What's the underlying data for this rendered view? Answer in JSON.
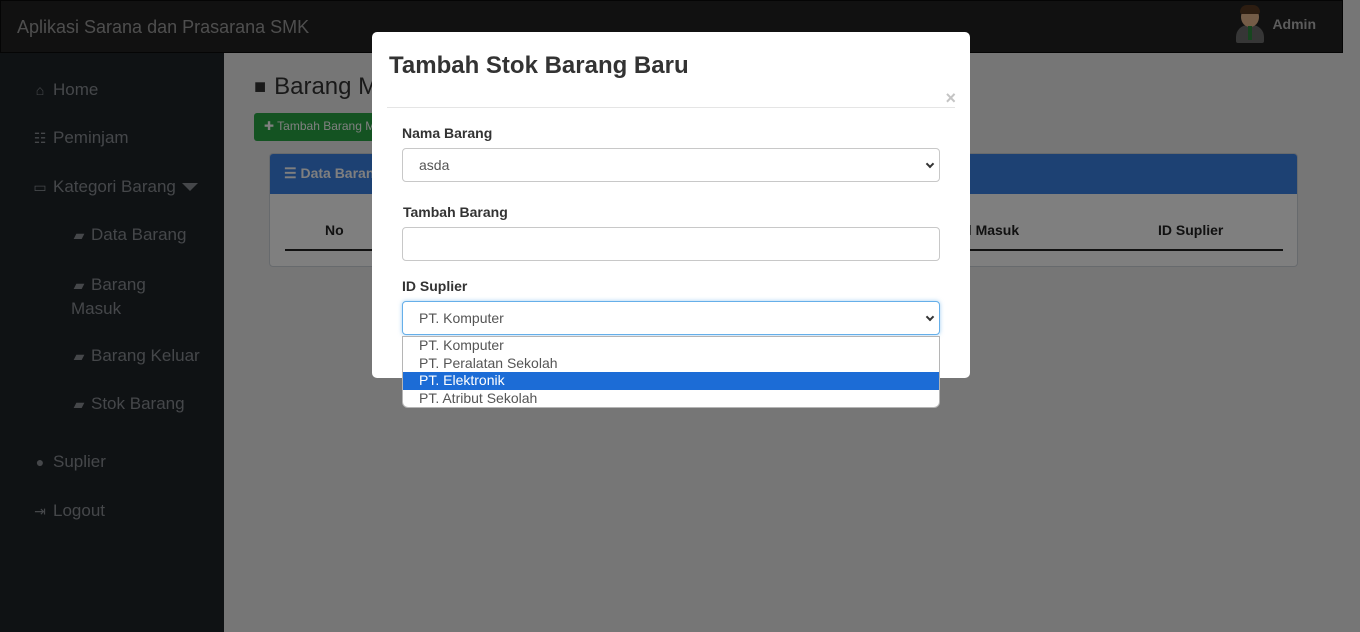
{
  "app": {
    "title": "Aplikasi Sarana dan Prasarana SMK"
  },
  "user": {
    "name": "Admin"
  },
  "sidebar": {
    "items": [
      {
        "label": "Home",
        "icon": "home-icon"
      },
      {
        "label": "Peminjam",
        "icon": "list-icon"
      },
      {
        "label": "Kategori Barang",
        "icon": "laptop-icon"
      },
      {
        "label": "Data Barang",
        "icon": "book-icon"
      },
      {
        "label": "Barang Masuk",
        "icon": "book-icon"
      },
      {
        "label": "Barang Keluar",
        "icon": "book-icon"
      },
      {
        "label": "Stok Barang",
        "icon": "book-icon"
      },
      {
        "label": "Suplier",
        "icon": "user-icon"
      },
      {
        "label": "Logout",
        "icon": "logout-icon"
      }
    ]
  },
  "main": {
    "page_title": "Barang M",
    "add_button": "Tambah Barang M",
    "card_title": "Data Barang",
    "columns": [
      "No",
      "al Masuk",
      "ID Suplier"
    ]
  },
  "modal": {
    "title": "Tambah Stok Barang Baru",
    "close": "×",
    "fields": {
      "nama_barang": {
        "label": "Nama Barang",
        "value": "asda"
      },
      "tambah_barang": {
        "label": "Tambah Barang",
        "value": ""
      },
      "id_suplier": {
        "label": "ID Suplier",
        "value": "PT. Komputer",
        "options": [
          "PT. Komputer",
          "PT. Peralatan Sekolah",
          "PT. Elektronik",
          "PT. Atribut Sekolah"
        ],
        "highlighted": "PT. Elektronik"
      }
    }
  },
  "colors": {
    "navbar": "#232323",
    "sidebar": "#1f2429",
    "accent": "#3b82e6",
    "success": "#28a745",
    "highlight": "#1c6cd6"
  }
}
